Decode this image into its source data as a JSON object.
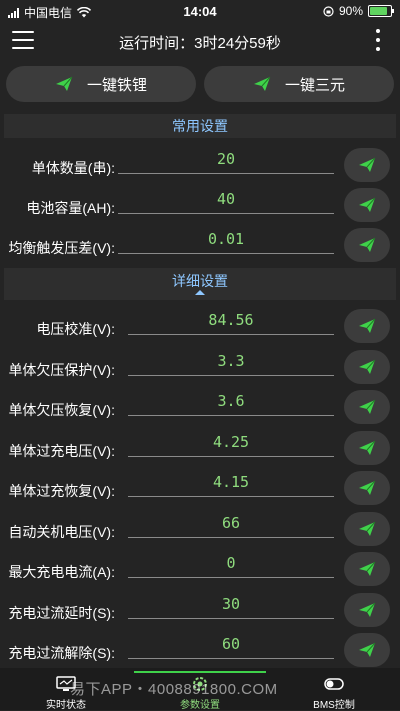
{
  "status_bar": {
    "carrier": "中国电信",
    "time": "14:04",
    "battery": "90%",
    "battery_level": 0.9
  },
  "header": {
    "title": "运行时间：3时24分59秒"
  },
  "quick_buttons": {
    "left_label": "一键铁锂",
    "right_label": "一键三元"
  },
  "sections": {
    "common": "常用设置",
    "detail": "详细设置"
  },
  "common_settings": [
    {
      "label": "单体数量(串):",
      "value": "20"
    },
    {
      "label": "电池容量(AH):",
      "value": "40"
    },
    {
      "label": "均衡触发压差(V):",
      "value": "0.01"
    }
  ],
  "detail_settings": [
    {
      "label": "电压校准(V):",
      "value": "84.56"
    },
    {
      "label": "单体欠压保护(V):",
      "value": "3.3"
    },
    {
      "label": "单体欠压恢复(V):",
      "value": "3.6"
    },
    {
      "label": "单体过充电压(V):",
      "value": "4.25"
    },
    {
      "label": "单体过充恢复(V):",
      "value": "4.15"
    },
    {
      "label": "自动关机电压(V):",
      "value": "66"
    },
    {
      "label": "最大充电电流(A):",
      "value": "0"
    },
    {
      "label": "充电过流延时(S):",
      "value": "30"
    },
    {
      "label": "充电过流解除(S):",
      "value": "60"
    }
  ],
  "tabbar": {
    "tab1": "实时状态",
    "tab2": "参数设置",
    "tab3": "BMS控制"
  },
  "watermark": "易下APP・4008891800.COM",
  "colors": {
    "accent": "#3fd14a",
    "value_text": "#8fdc7e",
    "section_text": "#8ec7ff"
  }
}
